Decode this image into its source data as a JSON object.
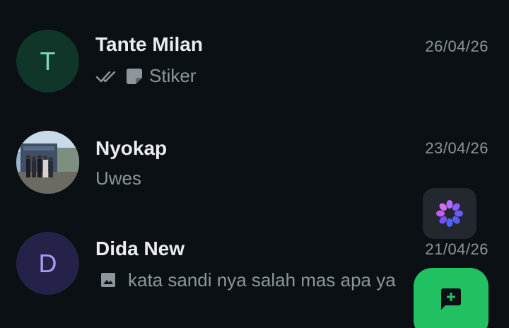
{
  "chats": [
    {
      "avatar_letter": "T",
      "name": "Tante Milan",
      "date": "26/04/26",
      "preview": "Stiker",
      "preview_icons": [
        "double-check-icon",
        "sticker-icon"
      ]
    },
    {
      "name": "Nyokap",
      "date": "23/04/26",
      "preview": "Uwes",
      "avatar_icon": "photo-avatar"
    },
    {
      "avatar_letter": "D",
      "name": "Dida New",
      "date": "21/04/26",
      "preview": "kata sandi nya salah mas apa ya",
      "preview_icons": [
        "image-icon"
      ]
    }
  ],
  "fabs": {
    "ai_icon": "meta-ai-icon",
    "new_chat_icon": "new-chat-icon"
  },
  "colors": {
    "background": "#0b1014",
    "name_text": "#e9edef",
    "secondary_text": "#8d969b",
    "accent_green": "#21c063",
    "avatar_t_bg": "#103529",
    "avatar_t_fg": "#7fd8c0",
    "avatar_d_bg": "#25224a",
    "avatar_d_fg": "#a99af5"
  }
}
